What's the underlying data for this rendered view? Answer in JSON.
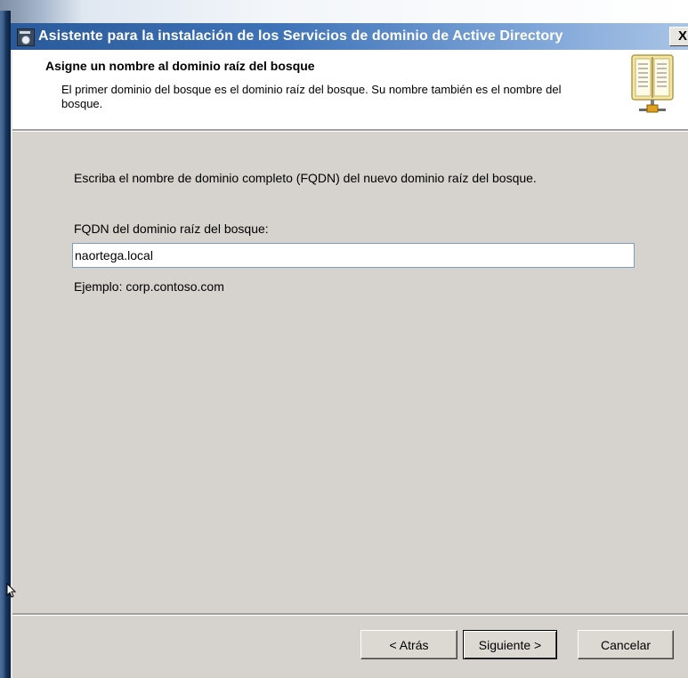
{
  "window": {
    "title": "Asistente para la instalación de los Servicios de dominio de Active Directory",
    "close_label": "X"
  },
  "header": {
    "title": "Asigne un nombre al dominio raíz del bosque",
    "description": "El primer dominio del bosque es el dominio raíz del bosque. Su nombre también es el nombre del bosque.",
    "icon": "directory-book-icon"
  },
  "content": {
    "instruction": "Escriba el nombre de dominio completo (FQDN) del nuevo dominio raíz del bosque.",
    "fqdn_label": "FQDN del dominio raíz del bosque:",
    "fqdn_value": "naortega.local",
    "example": "Ejemplo: corp.contoso.com"
  },
  "footer": {
    "back_label": "< Atrás",
    "next_label": "Siguiente >",
    "cancel_label": "Cancelar"
  },
  "colors": {
    "titlebar_start": "#2a5a9a",
    "titlebar_end": "#a9c4e6",
    "dialog_face": "#d6d3ce"
  }
}
